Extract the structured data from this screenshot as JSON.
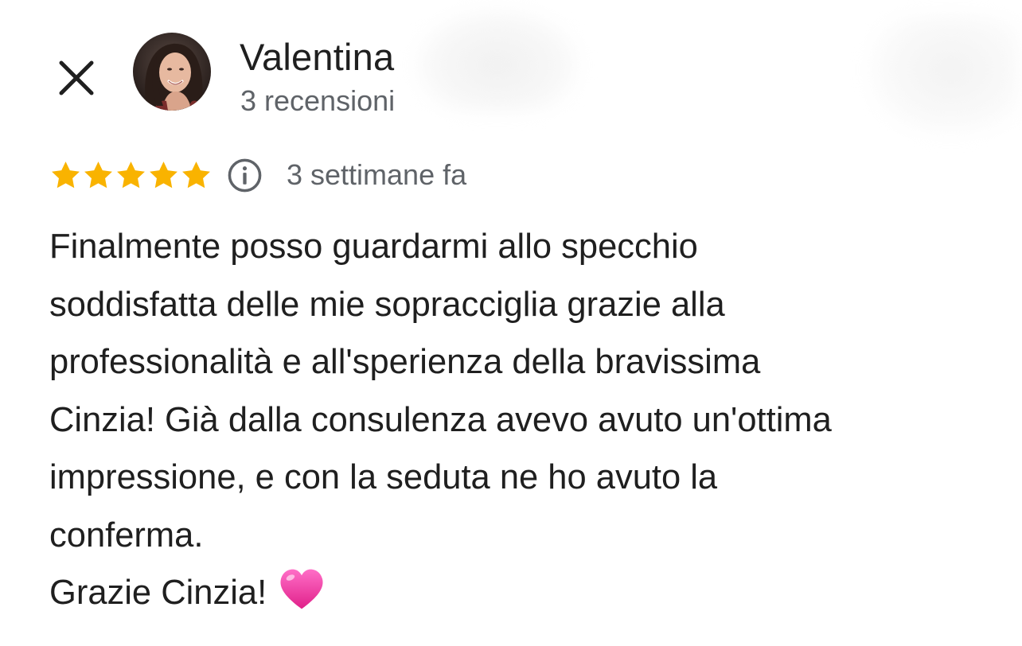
{
  "reviewer": {
    "name": "Valentina",
    "review_count": "3 recensioni"
  },
  "review": {
    "rating": 5,
    "rating_max": 5,
    "date": "3 settimane fa",
    "lines": [
      "Finalmente posso guardarmi allo specchio",
      "soddisfatta delle mie sopracciglia grazie alla",
      "professionalità e all'sperienza della bravissima",
      "Cinzia! Già dalla consulenza avevo avuto un'ottima",
      "impressione, e con la seduta ne ho avuto la",
      "conferma.",
      "Grazie Cinzia!"
    ]
  },
  "icons": {
    "close": "close-icon",
    "star": "star-icon",
    "info": "info-icon",
    "heart": "pink-heart-emoji"
  },
  "colors": {
    "star": "#f9b300",
    "text": "#1f1f1f",
    "secondary_text": "#5f6368",
    "heart": "#ee3aa0",
    "background": "#ffffff"
  }
}
